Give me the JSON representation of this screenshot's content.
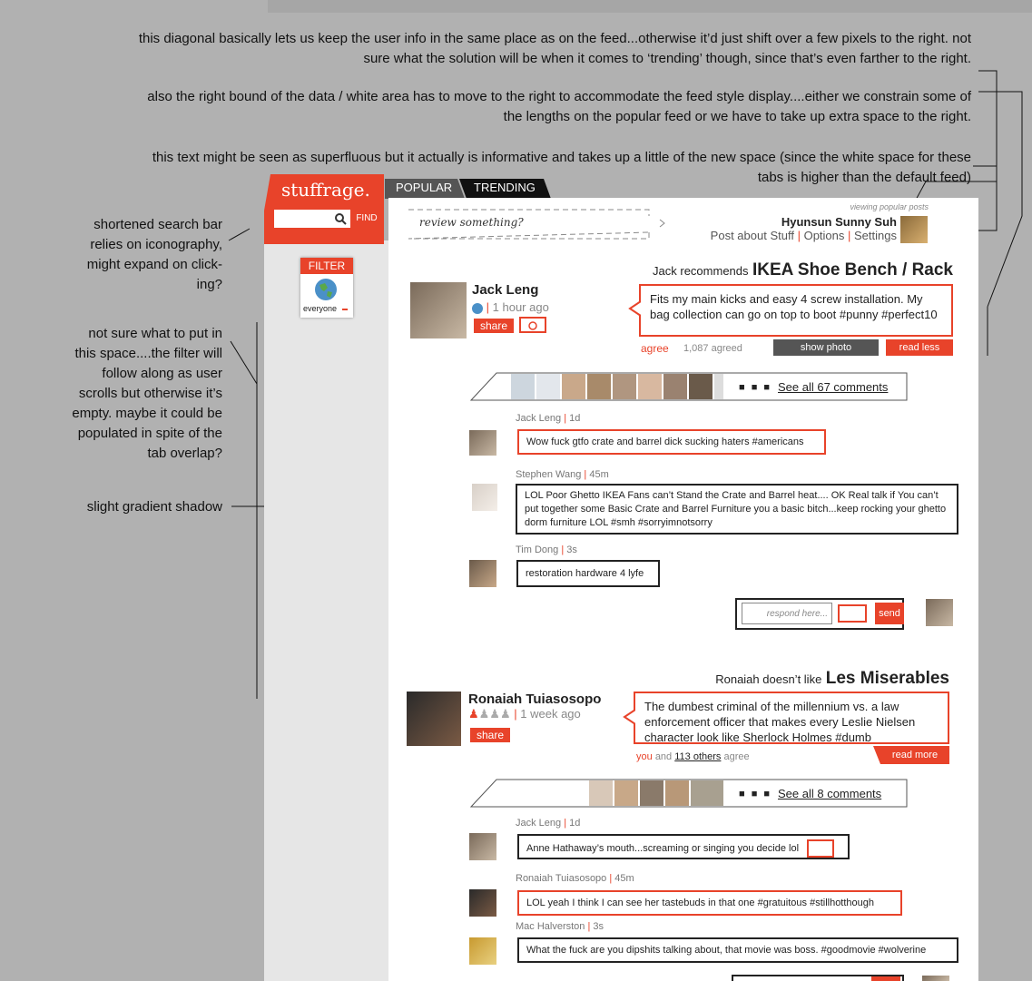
{
  "notes": {
    "n1a": "this diagonal basically lets us keep the user info in the same place as on the feed...otherwise it’d just shift over a few pixels to the right. not",
    "n1b": "sure what the solution will be when it comes to ‘trending’ though, since that’s even farther to the right.",
    "n2a": "also the right bound of the data / white area has to move to the right to accommodate the feed style display....either we constrain some of",
    "n2b": "the lengths on the popular feed or we have to take up extra space to the right.",
    "n3a": "this text might be seen as superfluous but it actually is informative and takes up a little of the new space (since the white space for these",
    "n3b": "tabs is higher than the default feed)",
    "left1": [
      "shortened search bar",
      "relies on iconography,",
      "might expand on click-",
      "ing?"
    ],
    "left2": [
      "not sure what to put in",
      "this space....the filter will",
      "follow along as user",
      "scrolls but otherwise it’s",
      "empty. maybe it could be",
      "populated in spite of the",
      "tab overlap?"
    ],
    "left3": "slight gradient shadow"
  },
  "brand": "stuffrage.",
  "search": {
    "find": "FIND"
  },
  "tabs": [
    "POPULAR",
    "TRENDING"
  ],
  "filter": {
    "label": "FILTER",
    "value": "everyone"
  },
  "header": {
    "review_placeholder": "review something?",
    "viewing": "viewing popular posts",
    "user": "Hyunsun Sunny Suh",
    "links": [
      "Post about Stuff",
      "Options",
      "Settings"
    ]
  },
  "post1": {
    "author": "Jack Leng",
    "time": "1 hour ago",
    "share": "share",
    "verb": "Jack recommends",
    "item": "IKEA Shoe Bench / Rack",
    "text": "Fits my main kicks and easy 4 screw installation. My bag collection can go on top to boot #punny #perfect10",
    "agree": "agree",
    "agreed": "1,087 agreed",
    "show_photo": "show photo",
    "read_less": "read less",
    "see_all": "See all 67 comments",
    "comments": [
      {
        "name": "Jack Leng",
        "time": "1d",
        "text": "Wow fuck gtfo crate and barrel dick sucking haters #americans"
      },
      {
        "name": "Stephen Wang",
        "time": "45m",
        "text": "LOL Poor Ghetto IKEA Fans can’t Stand the Crate and Barrel heat.... OK Real talk if You can’t put together some Basic Crate and Barrel Furniture you a basic bitch...keep rocking your ghetto dorm furniture LOL #smh #sorryimnotsorry"
      },
      {
        "name": "Tim Dong",
        "time": "3s",
        "text": "restoration hardware 4 lyfe"
      }
    ],
    "respond": "respond here...",
    "send": "send"
  },
  "post2": {
    "author": "Ronaiah Tuiasosopo",
    "time": "1 week ago",
    "share": "share",
    "verb": "Ronaiah doesn’t like",
    "item": "Les Miserables",
    "text": "The dumbest criminal of the millennium vs. a law enforcement officer that makes every Leslie Nielsen character look like Sherlock Holmes #dumb",
    "you": "you",
    "and": "and",
    "others": "113 others",
    "agree": "agree",
    "read_more": "read more",
    "see_all": "See all 8 comments",
    "comments": [
      {
        "name": "Jack Leng",
        "time": "1d",
        "text": "Anne Hathaway’s mouth...screaming or singing you decide lol"
      },
      {
        "name": "Ronaiah Tuiasosopo",
        "time": "45m",
        "text": "LOL yeah I think I can see her tastebuds in that one #gratuitous #stillhotthough"
      },
      {
        "name": "Mac Halverston",
        "time": "3s",
        "text": "What the fuck are you dipshits talking about, that movie was boss. #goodmovie #wolverine"
      }
    ]
  },
  "colors": {
    "accent": "#e8432a",
    "bg": "#b1b1b1",
    "sidebar": "#e6e6e6"
  }
}
